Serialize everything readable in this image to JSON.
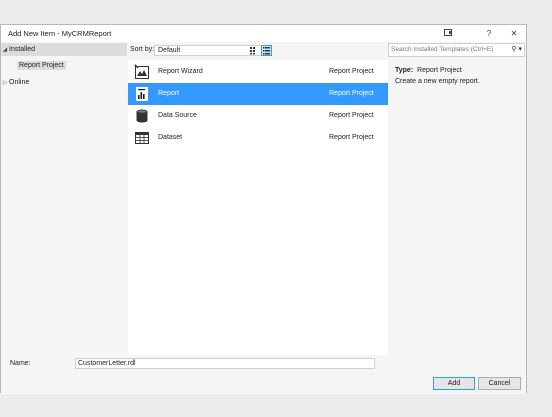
{
  "window": {
    "title": "Add New Item - MyCRMReport",
    "help_label": "?",
    "close_label": "✕"
  },
  "nav": {
    "installed_label": "Installed",
    "report_project_label": "Report Project",
    "online_label": "Online"
  },
  "toolbar": {
    "sort_label": "Sort by:",
    "sort_value": "Default"
  },
  "templates": [
    {
      "name": "Report Wizard",
      "category": "Report Project",
      "icon": "report-wizard-icon"
    },
    {
      "name": "Report",
      "category": "Report Project",
      "icon": "report-icon"
    },
    {
      "name": "Data Source",
      "category": "Report Project",
      "icon": "data-source-icon"
    },
    {
      "name": "Dataset",
      "category": "Report Project",
      "icon": "dataset-icon"
    }
  ],
  "selected_index": 1,
  "search": {
    "placeholder": "Search Installed Templates (Ctrl+E)"
  },
  "details": {
    "type_label": "Type:",
    "type_value": "Report Project",
    "description": "Create a new empty report."
  },
  "footer": {
    "name_label": "Name:",
    "name_value": "CustomerLetter.rdl",
    "add_label": "Add",
    "cancel_label": "Cancel"
  },
  "colors": {
    "selection": "#3399ff",
    "panel": "#f5f5f5"
  }
}
